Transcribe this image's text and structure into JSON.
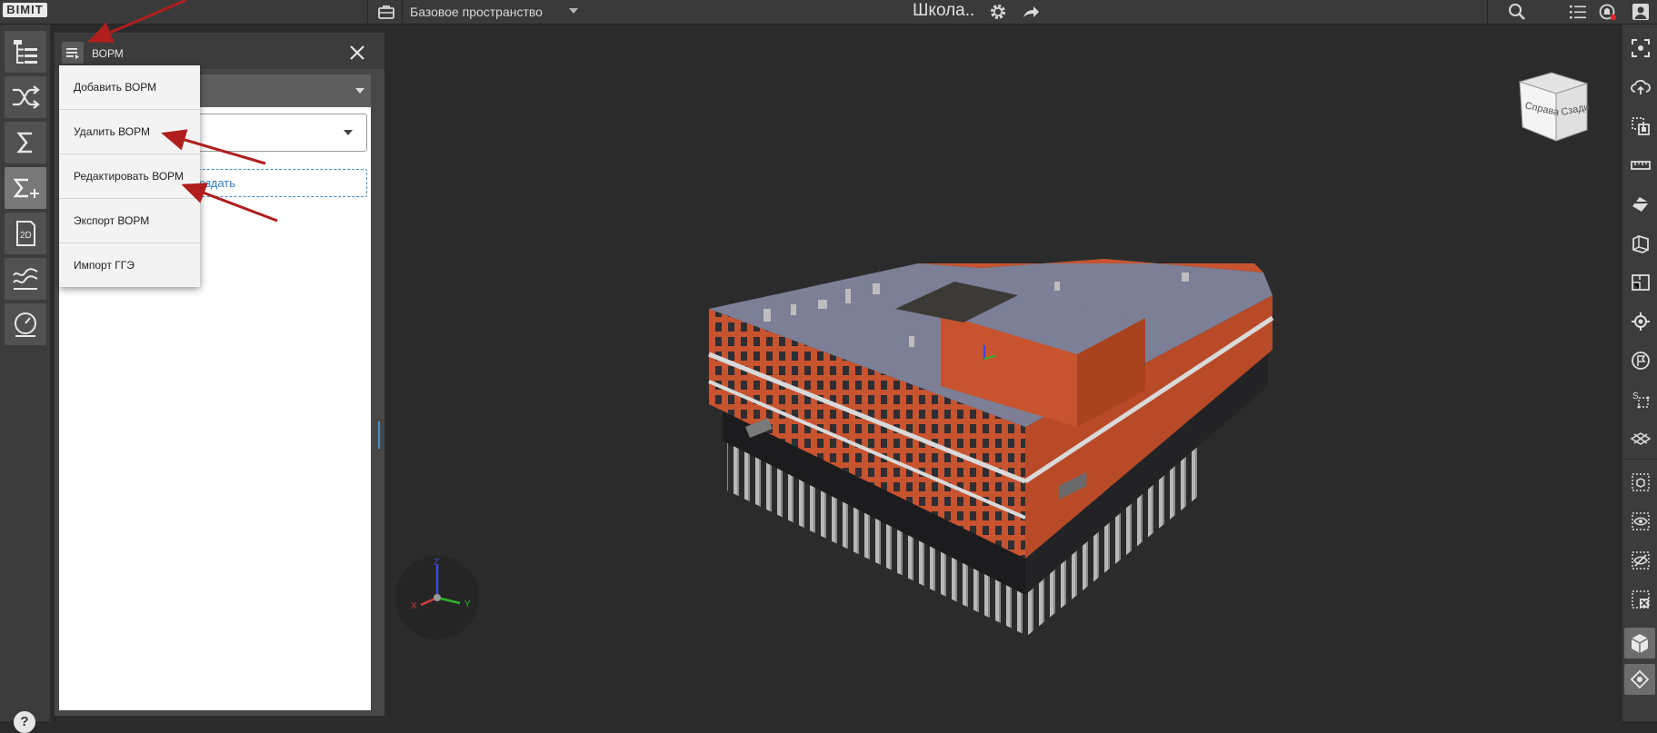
{
  "app": {
    "logo": "BIMIT",
    "workspace": "Базовое пространство",
    "project": "Школа.."
  },
  "left_toolbar": {
    "tools": [
      {
        "icon": "model-tree-icon",
        "active": false
      },
      {
        "icon": "shuffle-icon",
        "active": false
      },
      {
        "icon": "sigma-icon",
        "active": false
      },
      {
        "icon": "sigma-plus-icon",
        "active": true
      },
      {
        "icon": "drawing-2d-icon",
        "active": false
      },
      {
        "icon": "chart-lines-icon",
        "active": false
      },
      {
        "icon": "gauge-icon",
        "active": false
      }
    ],
    "help": "?"
  },
  "panel": {
    "title": "ВОРМ",
    "create_label": "оздать"
  },
  "menu": {
    "items": [
      "Добавить ВОРМ",
      "Удалить ВОРМ",
      "Редактировать ВОРМ",
      "Экспорт ВОРМ",
      "Импорт ГГЭ"
    ]
  },
  "viewcube": {
    "front": "Справа",
    "right": "Сзади"
  },
  "axes": {
    "x": "X",
    "y": "Y",
    "z": "Z"
  },
  "colors": {
    "topbar": "#3a3a3a",
    "viewport": "#2b2b2b",
    "brick": "#c7532f",
    "roof": "#7c7f95",
    "accent_link": "#2d7fc1",
    "annotation_arrow": "#b01e1e"
  }
}
